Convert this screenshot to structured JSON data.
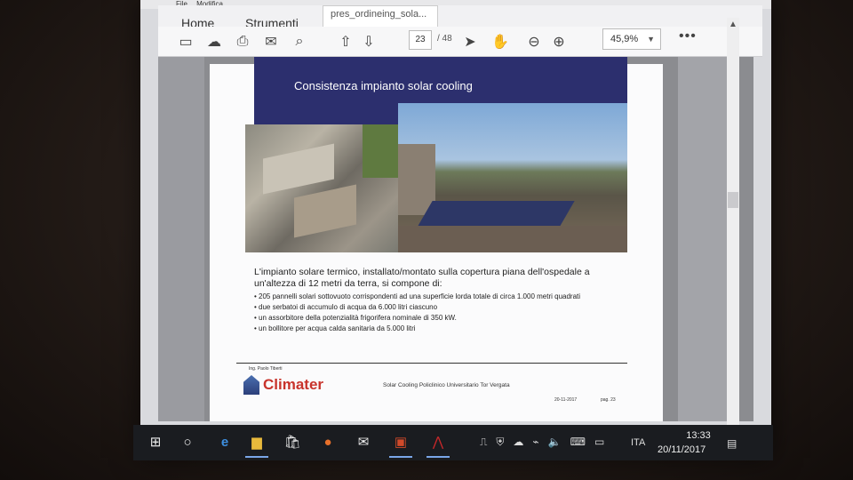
{
  "menubar": {
    "file": "File",
    "modifica": "Modifica"
  },
  "tabs": {
    "home": "Home",
    "tools": "Strumenti",
    "document": "pres_ordineing_sola..."
  },
  "toolbar": {
    "page_current": "23",
    "page_total": "/ 48",
    "zoom": "45,9%",
    "more": "•••",
    "icons": [
      "save-icon",
      "upload-icon",
      "print-icon",
      "mail-icon",
      "search-icon",
      "page-up-icon",
      "page-down-icon",
      "select-cursor-icon",
      "hand-tool-icon",
      "zoom-out-icon",
      "zoom-in-icon"
    ]
  },
  "slide": {
    "title": "Consistenza impianto solar cooling",
    "intro": "L'impianto solare termico, installato/montato sulla copertura piana dell'ospedale a un'altezza di 12 metri da terra, si compone di:",
    "bullets": [
      "205 pannelli solari sottovuoto corrispondenti ad una superficie lorda totale di circa 1.000 metri quadrati",
      "due serbatoi di accumulo di acqua da 6.000 litri ciascuno",
      "un assorbitore della potenzialità frigorifera nominale di 350 kW.",
      "un bollitore per acqua calda sanitaria da 5.000 litri"
    ],
    "author": "Ing. Paolo Tiberti",
    "logo": "Climater",
    "footer_center": "Solar Cooling Policlinico Universitario Tor Vergata",
    "footer_date": "20-11-2017",
    "footer_page": "pag. 23"
  },
  "taskbar": {
    "language": "ITA",
    "time": "13:33",
    "date": "20/11/2017"
  }
}
